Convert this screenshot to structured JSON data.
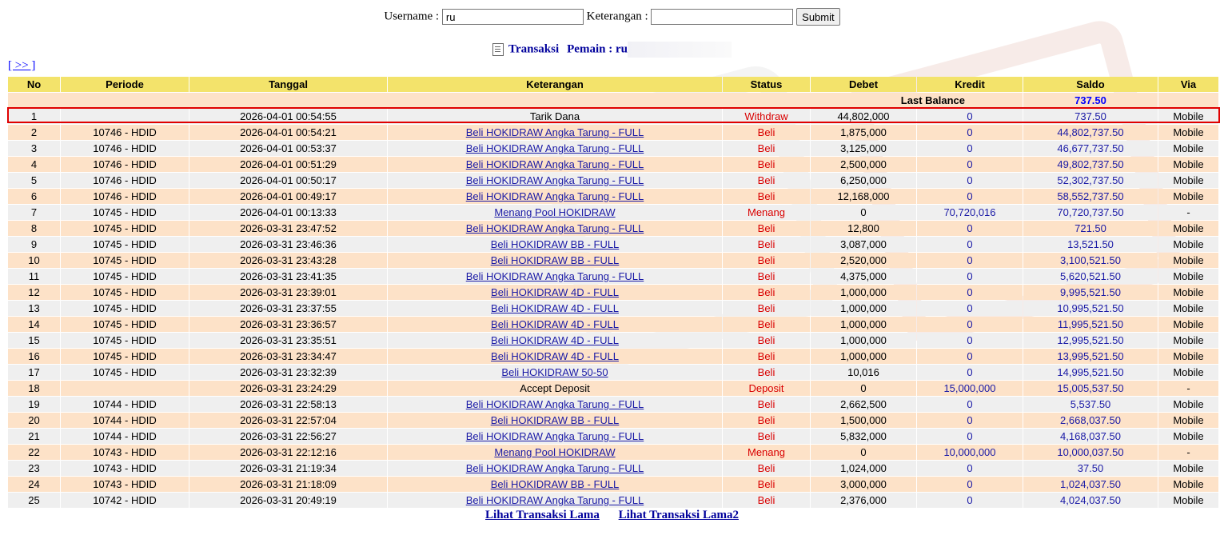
{
  "search": {
    "username_label": "Username :",
    "username_value": "ru",
    "keterangan_label": "Keterangan :",
    "keterangan_value": "",
    "submit_label": "Submit"
  },
  "title": {
    "transaksi": "Transaksi",
    "pemain_label": "Pemain : ru"
  },
  "nav": {
    "next_label": "[ >> ]"
  },
  "table": {
    "headers": [
      "No",
      "Periode",
      "Tanggal",
      "Keterangan",
      "Status",
      "Debet",
      "Kredit",
      "Saldo",
      "Via"
    ],
    "last_balance_label": "Last Balance",
    "last_balance_value": "737.50",
    "rows": [
      {
        "no": "1",
        "periode": "",
        "tanggal": "2026-04-01 00:54:55",
        "ket": "Tarik Dana",
        "link": false,
        "status": "Withdraw",
        "debet": "44,802,000",
        "kredit": "0",
        "saldo": "737.50",
        "via": "Mobile"
      },
      {
        "no": "2",
        "periode": "10746 - HDID",
        "tanggal": "2026-04-01 00:54:21",
        "ket": "Beli HOKIDRAW Angka Tarung - FULL",
        "link": true,
        "status": "Beli",
        "debet": "1,875,000",
        "kredit": "0",
        "saldo": "44,802,737.50",
        "via": "Mobile"
      },
      {
        "no": "3",
        "periode": "10746 - HDID",
        "tanggal": "2026-04-01 00:53:37",
        "ket": "Beli HOKIDRAW Angka Tarung - FULL",
        "link": true,
        "status": "Beli",
        "debet": "3,125,000",
        "kredit": "0",
        "saldo": "46,677,737.50",
        "via": "Mobile"
      },
      {
        "no": "4",
        "periode": "10746 - HDID",
        "tanggal": "2026-04-01 00:51:29",
        "ket": "Beli HOKIDRAW Angka Tarung - FULL",
        "link": true,
        "status": "Beli",
        "debet": "2,500,000",
        "kredit": "0",
        "saldo": "49,802,737.50",
        "via": "Mobile"
      },
      {
        "no": "5",
        "periode": "10746 - HDID",
        "tanggal": "2026-04-01 00:50:17",
        "ket": "Beli HOKIDRAW Angka Tarung - FULL",
        "link": true,
        "status": "Beli",
        "debet": "6,250,000",
        "kredit": "0",
        "saldo": "52,302,737.50",
        "via": "Mobile"
      },
      {
        "no": "6",
        "periode": "10746 - HDID",
        "tanggal": "2026-04-01 00:49:17",
        "ket": "Beli HOKIDRAW Angka Tarung - FULL",
        "link": true,
        "status": "Beli",
        "debet": "12,168,000",
        "kredit": "0",
        "saldo": "58,552,737.50",
        "via": "Mobile"
      },
      {
        "no": "7",
        "periode": "10745 - HDID",
        "tanggal": "2026-04-01 00:13:33",
        "ket": "Menang Pool HOKIDRAW",
        "link": true,
        "status": "Menang",
        "debet": "0",
        "kredit": "70,720,016",
        "saldo": "70,720,737.50",
        "via": "-"
      },
      {
        "no": "8",
        "periode": "10745 - HDID",
        "tanggal": "2026-03-31 23:47:52",
        "ket": "Beli HOKIDRAW Angka Tarung - FULL",
        "link": true,
        "status": "Beli",
        "debet": "12,800",
        "kredit": "0",
        "saldo": "721.50",
        "via": "Mobile"
      },
      {
        "no": "9",
        "periode": "10745 - HDID",
        "tanggal": "2026-03-31 23:46:36",
        "ket": "Beli HOKIDRAW BB - FULL",
        "link": true,
        "status": "Beli",
        "debet": "3,087,000",
        "kredit": "0",
        "saldo": "13,521.50",
        "via": "Mobile"
      },
      {
        "no": "10",
        "periode": "10745 - HDID",
        "tanggal": "2026-03-31 23:43:28",
        "ket": "Beli HOKIDRAW BB - FULL",
        "link": true,
        "status": "Beli",
        "debet": "2,520,000",
        "kredit": "0",
        "saldo": "3,100,521.50",
        "via": "Mobile"
      },
      {
        "no": "11",
        "periode": "10745 - HDID",
        "tanggal": "2026-03-31 23:41:35",
        "ket": "Beli HOKIDRAW Angka Tarung - FULL",
        "link": true,
        "status": "Beli",
        "debet": "4,375,000",
        "kredit": "0",
        "saldo": "5,620,521.50",
        "via": "Mobile"
      },
      {
        "no": "12",
        "periode": "10745 - HDID",
        "tanggal": "2026-03-31 23:39:01",
        "ket": "Beli HOKIDRAW 4D - FULL",
        "link": true,
        "status": "Beli",
        "debet": "1,000,000",
        "kredit": "0",
        "saldo": "9,995,521.50",
        "via": "Mobile"
      },
      {
        "no": "13",
        "periode": "10745 - HDID",
        "tanggal": "2026-03-31 23:37:55",
        "ket": "Beli HOKIDRAW 4D - FULL",
        "link": true,
        "status": "Beli",
        "debet": "1,000,000",
        "kredit": "0",
        "saldo": "10,995,521.50",
        "via": "Mobile"
      },
      {
        "no": "14",
        "periode": "10745 - HDID",
        "tanggal": "2026-03-31 23:36:57",
        "ket": "Beli HOKIDRAW 4D - FULL",
        "link": true,
        "status": "Beli",
        "debet": "1,000,000",
        "kredit": "0",
        "saldo": "11,995,521.50",
        "via": "Mobile"
      },
      {
        "no": "15",
        "periode": "10745 - HDID",
        "tanggal": "2026-03-31 23:35:51",
        "ket": "Beli HOKIDRAW 4D - FULL",
        "link": true,
        "status": "Beli",
        "debet": "1,000,000",
        "kredit": "0",
        "saldo": "12,995,521.50",
        "via": "Mobile"
      },
      {
        "no": "16",
        "periode": "10745 - HDID",
        "tanggal": "2026-03-31 23:34:47",
        "ket": "Beli HOKIDRAW 4D - FULL",
        "link": true,
        "status": "Beli",
        "debet": "1,000,000",
        "kredit": "0",
        "saldo": "13,995,521.50",
        "via": "Mobile"
      },
      {
        "no": "17",
        "periode": "10745 - HDID",
        "tanggal": "2026-03-31 23:32:39",
        "ket": "Beli HOKIDRAW 50-50",
        "link": true,
        "status": "Beli",
        "debet": "10,016",
        "kredit": "0",
        "saldo": "14,995,521.50",
        "via": "Mobile"
      },
      {
        "no": "18",
        "periode": "",
        "tanggal": "2026-03-31 23:24:29",
        "ket": "Accept Deposit",
        "link": false,
        "status": "Deposit",
        "debet": "0",
        "kredit": "15,000,000",
        "saldo": "15,005,537.50",
        "via": "-"
      },
      {
        "no": "19",
        "periode": "10744 - HDID",
        "tanggal": "2026-03-31 22:58:13",
        "ket": "Beli HOKIDRAW Angka Tarung - FULL",
        "link": true,
        "status": "Beli",
        "debet": "2,662,500",
        "kredit": "0",
        "saldo": "5,537.50",
        "via": "Mobile"
      },
      {
        "no": "20",
        "periode": "10744 - HDID",
        "tanggal": "2026-03-31 22:57:04",
        "ket": "Beli HOKIDRAW BB - FULL",
        "link": true,
        "status": "Beli",
        "debet": "1,500,000",
        "kredit": "0",
        "saldo": "2,668,037.50",
        "via": "Mobile"
      },
      {
        "no": "21",
        "periode": "10744 - HDID",
        "tanggal": "2026-03-31 22:56:27",
        "ket": "Beli HOKIDRAW Angka Tarung - FULL",
        "link": true,
        "status": "Beli",
        "debet": "5,832,000",
        "kredit": "0",
        "saldo": "4,168,037.50",
        "via": "Mobile"
      },
      {
        "no": "22",
        "periode": "10743 - HDID",
        "tanggal": "2026-03-31 22:12:16",
        "ket": "Menang Pool HOKIDRAW",
        "link": true,
        "status": "Menang",
        "debet": "0",
        "kredit": "10,000,000",
        "saldo": "10,000,037.50",
        "via": "-"
      },
      {
        "no": "23",
        "periode": "10743 - HDID",
        "tanggal": "2026-03-31 21:19:34",
        "ket": "Beli HOKIDRAW Angka Tarung - FULL",
        "link": true,
        "status": "Beli",
        "debet": "1,024,000",
        "kredit": "0",
        "saldo": "37.50",
        "via": "Mobile"
      },
      {
        "no": "24",
        "periode": "10743 - HDID",
        "tanggal": "2026-03-31 21:18:09",
        "ket": "Beli HOKIDRAW BB - FULL",
        "link": true,
        "status": "Beli",
        "debet": "3,000,000",
        "kredit": "0",
        "saldo": "1,024,037.50",
        "via": "Mobile"
      },
      {
        "no": "25",
        "periode": "10742 - HDID",
        "tanggal": "2026-03-31 20:49:19",
        "ket": "Beli HOKIDRAW Angka Tarung - FULL",
        "link": true,
        "status": "Beli",
        "debet": "2,376,000",
        "kredit": "0",
        "saldo": "4,024,037.50",
        "via": "Mobile"
      }
    ]
  },
  "footer": {
    "link1": "Lihat Transaksi Lama",
    "link2": "Lihat Transaksi Lama2"
  },
  "colors": {
    "header_bg": "#f3e36b",
    "row_even_bg": "#fde2c8",
    "row_odd_bg": "#efefef",
    "status_red": "#d90000",
    "link_blue": "#1a1aa6",
    "highlight_border": "#e00000"
  },
  "icons": {
    "title_icon": "clipboard-icon"
  }
}
